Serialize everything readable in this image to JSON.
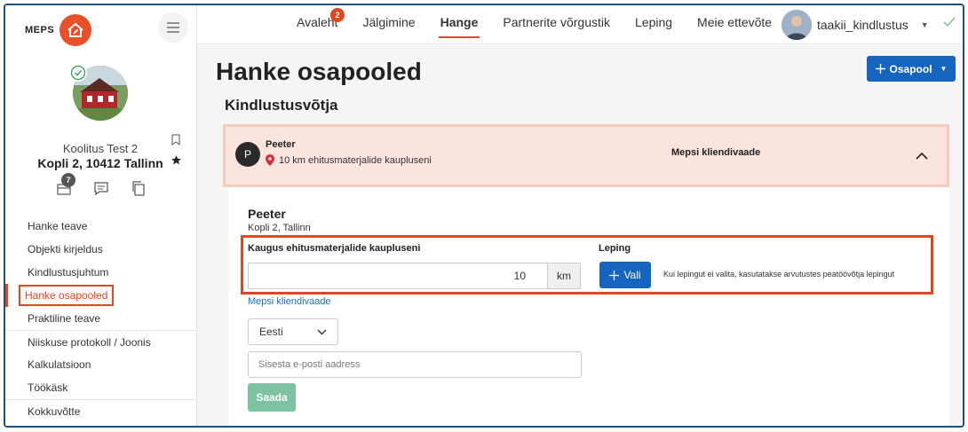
{
  "sidebar": {
    "logo_text": "MEPS",
    "project": {
      "name": "Koolitus Test 2",
      "address": "Kopli 2, 10412 Tallinn",
      "notifications_count": "7"
    },
    "nav": [
      {
        "label": "Hanke teave"
      },
      {
        "label": "Objekti kirjeldus"
      },
      {
        "label": "Kindlustusjuhtum"
      },
      {
        "label": "Hanke osapooled",
        "active": true
      },
      {
        "label": "Praktiline teave"
      },
      {
        "label": "Niiskuse protokoll / Joonis"
      },
      {
        "label": "Kalkulatsioon"
      },
      {
        "label": "Töökäsk"
      },
      {
        "label": "Kokkuvõtte"
      }
    ]
  },
  "topbar": {
    "tabs": [
      {
        "label": "Avaleht",
        "badge": "2"
      },
      {
        "label": "Jälgimine"
      },
      {
        "label": "Hange",
        "active": true
      },
      {
        "label": "Partnerite võrgustik"
      },
      {
        "label": "Leping"
      },
      {
        "label": "Meie ettevõte"
      }
    ],
    "user_name": "taakii_kindlustus"
  },
  "main": {
    "title": "Hanke osapooled",
    "add_button_label": "Osapool",
    "section_title": "Kindlustusvõtja",
    "party": {
      "avatar_letter": "P",
      "name": "Peeter",
      "distance_text": "10 km ehitusmaterjalide kaupluseni",
      "view_label": "Mepsi kliendivaade",
      "body_name": "Peeter",
      "body_address": "Kopli 2, Tallinn",
      "distance_label": "Kaugus ehitusmaterjalide kaupluseni",
      "distance_value": "10",
      "distance_unit": "km",
      "contract_label": "Leping",
      "choose_button_label": "Vali",
      "contract_hint": "Kui lepingut ei valita, kasutatakse arvutustes peatöövõtja lepingut",
      "client_view_link": "Mepsi kliendivaade",
      "language_selected": "Eesti",
      "email_placeholder": "Sisesta e-posti aadress",
      "send_button_label": "Saada"
    }
  },
  "colors": {
    "accent": "#e0461f",
    "primary": "#1565c0",
    "send_button": "#7dc3a1",
    "party_header_bg": "#fbe4dd"
  }
}
